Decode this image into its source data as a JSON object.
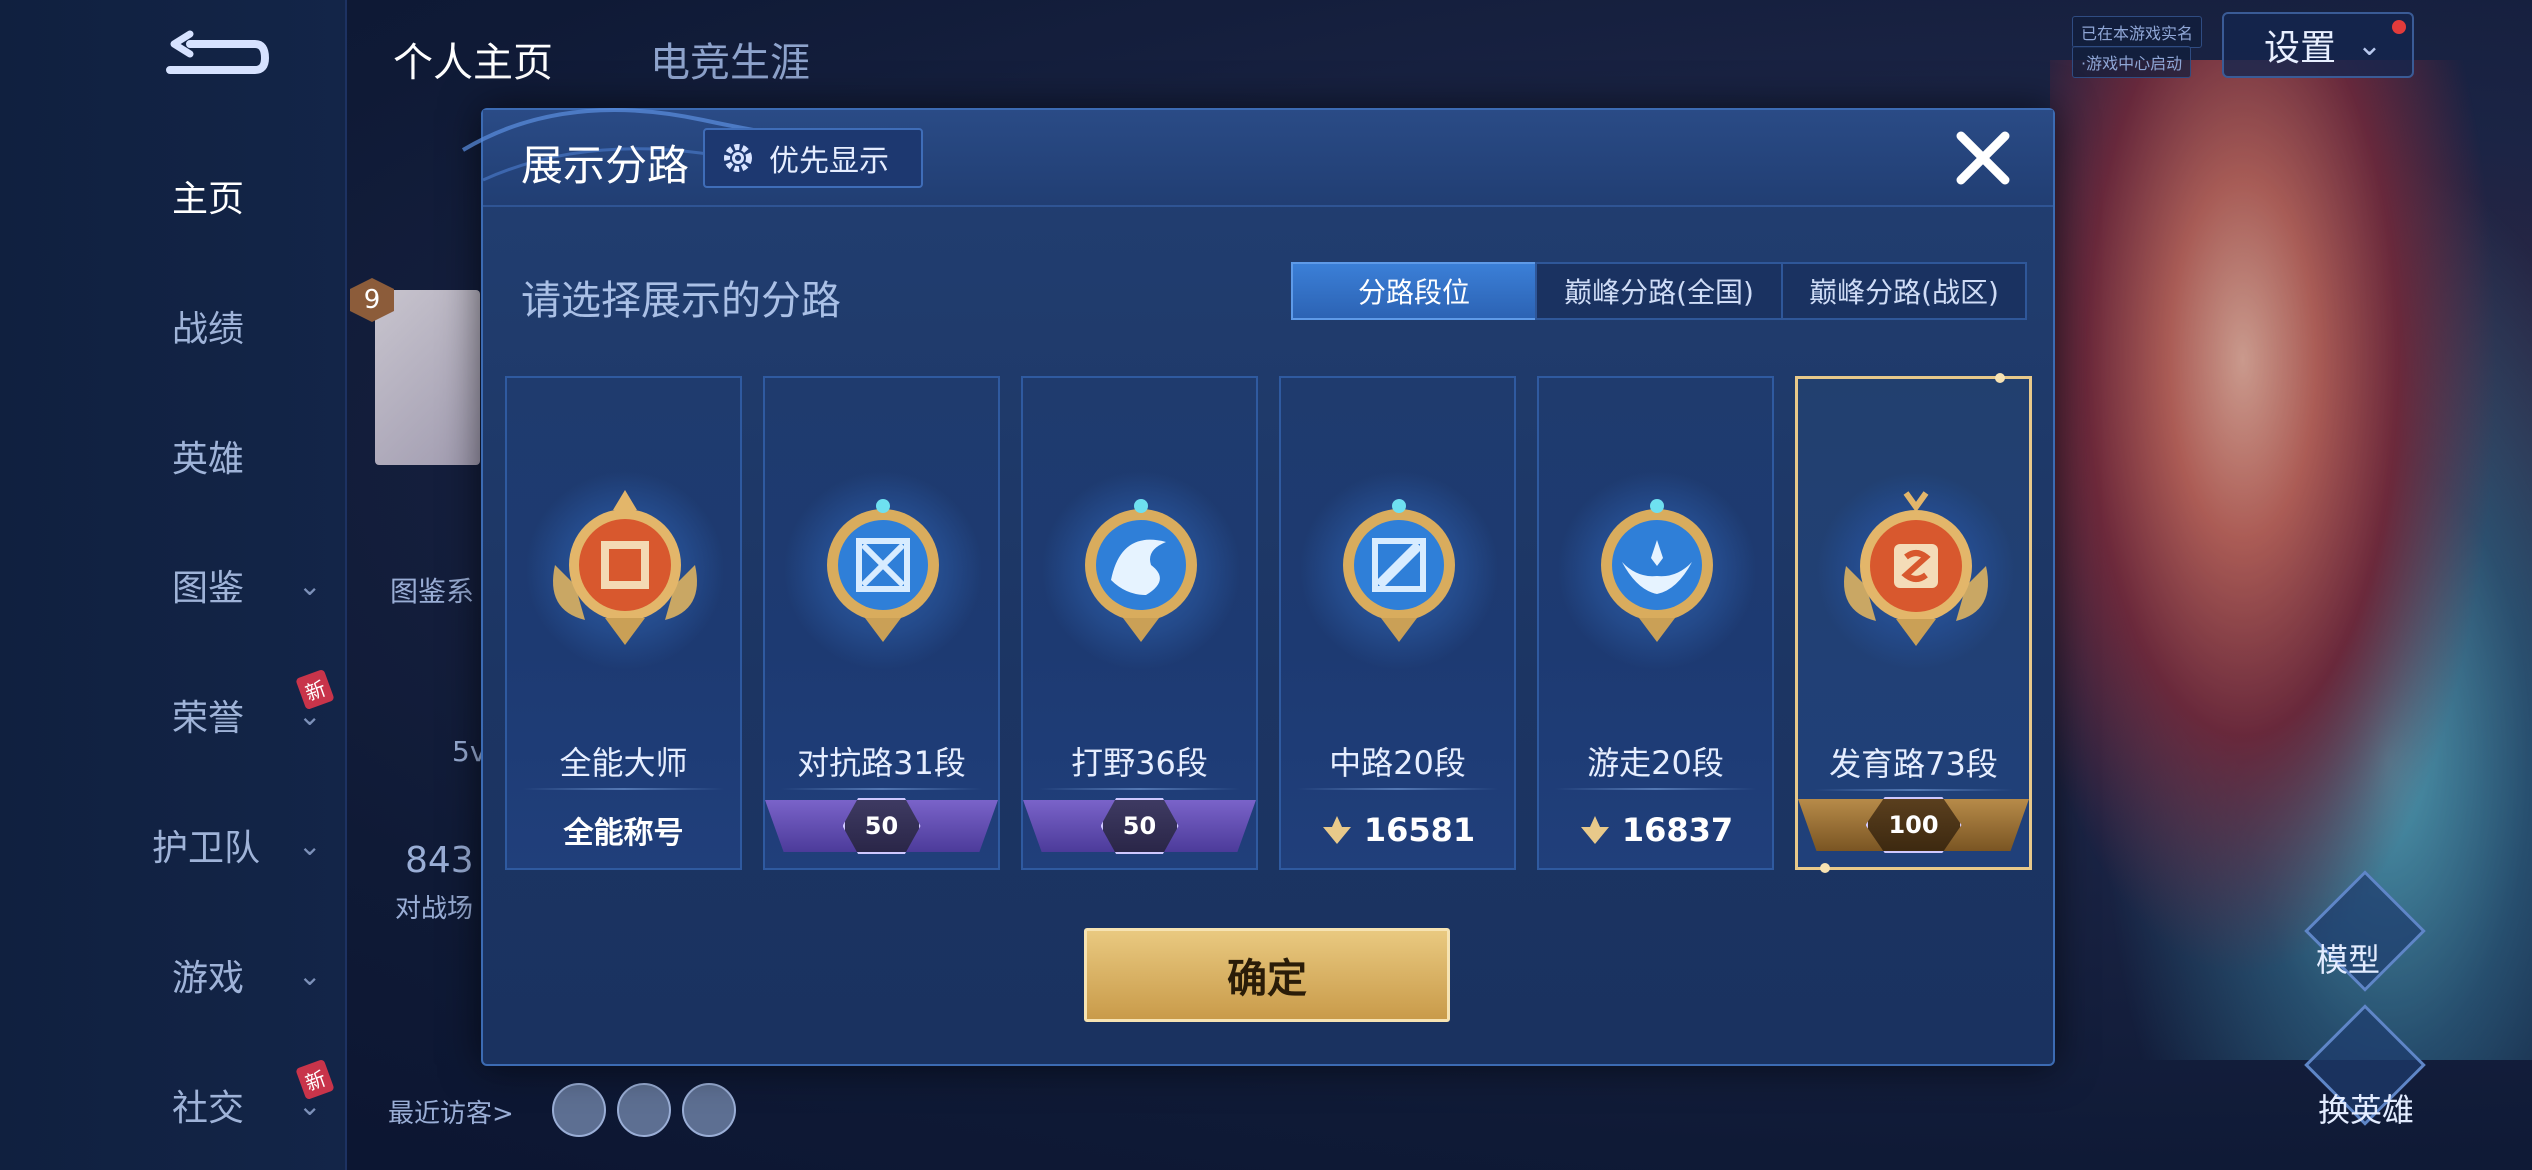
{
  "top_nav": {
    "tabs": [
      "个人主页",
      "电竞生涯"
    ]
  },
  "sidebar": {
    "items": [
      {
        "label": "主页",
        "active": true,
        "chevron": false,
        "new": false
      },
      {
        "label": "战绩",
        "active": false,
        "chevron": false,
        "new": false
      },
      {
        "label": "英雄",
        "active": false,
        "chevron": false,
        "new": false
      },
      {
        "label": "图鉴",
        "active": false,
        "chevron": true,
        "new": false
      },
      {
        "label": "荣誉",
        "active": false,
        "chevron": true,
        "new": true
      },
      {
        "label": "护卫队",
        "active": false,
        "chevron": true,
        "new": false
      },
      {
        "label": "游戏",
        "active": false,
        "chevron": true,
        "new": false
      },
      {
        "label": "社交",
        "active": false,
        "chevron": true,
        "new": true
      }
    ],
    "new_badge": "新"
  },
  "header_right": {
    "settings_label": "设置",
    "tag_lines": [
      "已在本游戏实名",
      "·游戏中心启动"
    ]
  },
  "background_profile": {
    "level": "9",
    "partial_text_1": "图鉴系",
    "partial_text_2": "5v",
    "partial_text_3": "843",
    "partial_text_4": "对战场",
    "recent_visitors": "最近访客>"
  },
  "hero_side": {
    "model_label": "模型",
    "switch_hero_label": "换英雄"
  },
  "modal": {
    "title": "展示分路",
    "priority_button": "优先显示",
    "subtitle": "请选择展示的分路",
    "segments": [
      "分路段位",
      "巅峰分路(全国)",
      "巅峰分路(战区)"
    ],
    "active_segment": 0,
    "cards": [
      {
        "name": "全能大师",
        "footer_type": "text",
        "footer": "全能称号",
        "selected": false
      },
      {
        "name": "对抗路31段",
        "footer_type": "ribbon",
        "footer": "50",
        "selected": false
      },
      {
        "name": "打野36段",
        "footer_type": "ribbon",
        "footer": "50",
        "selected": false
      },
      {
        "name": "中路20段",
        "footer_type": "score",
        "footer": "16581",
        "selected": false
      },
      {
        "name": "游走20段",
        "footer_type": "score",
        "footer": "16837",
        "selected": false
      },
      {
        "name": "发育路73段",
        "footer_type": "ribbon-gold",
        "footer": "100",
        "selected": true
      }
    ],
    "confirm_label": "确定"
  },
  "colors": {
    "accent_blue": "#3b7fd7",
    "gold": "#e9c980",
    "panel": "#1c3563"
  }
}
